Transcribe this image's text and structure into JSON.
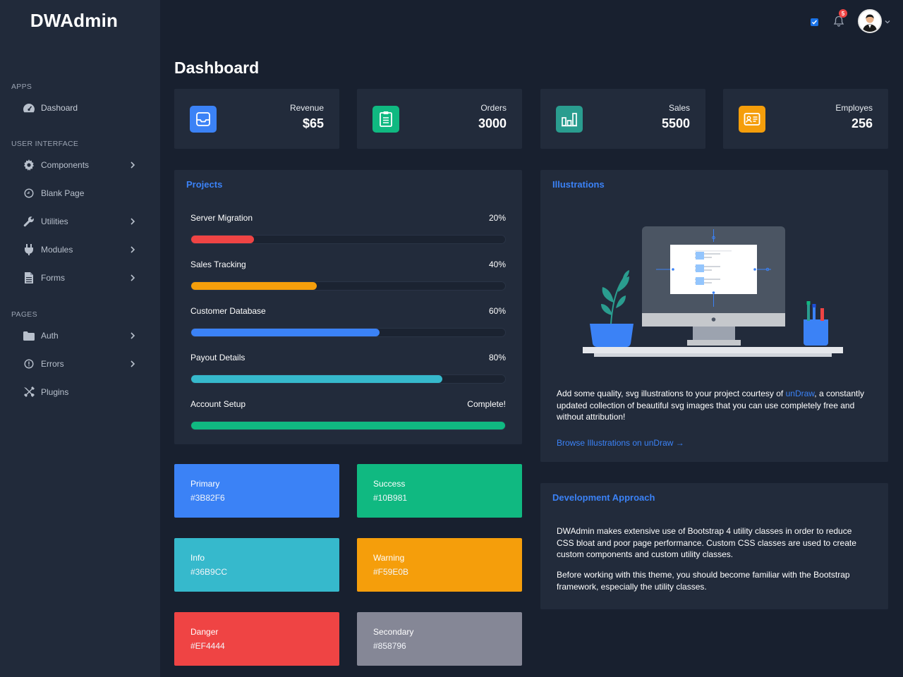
{
  "brand": "DWAdmin",
  "sidebar": {
    "sections": [
      {
        "title": "APPS"
      },
      {
        "title": "USER INTERFACE"
      },
      {
        "title": "PAGES"
      }
    ],
    "items": [
      {
        "label": "Dashoard",
        "icon": "tachometer-icon"
      },
      {
        "label": "Components",
        "icon": "gear-icon"
      },
      {
        "label": "Blank Page",
        "icon": "clock-icon"
      },
      {
        "label": "Utilities",
        "icon": "wrench-icon"
      },
      {
        "label": "Modules",
        "icon": "plug-icon"
      },
      {
        "label": "Forms",
        "icon": "file-icon"
      },
      {
        "label": "Auth",
        "icon": "folder-icon"
      },
      {
        "label": "Errors",
        "icon": "info-circle-icon"
      },
      {
        "label": "Plugins",
        "icon": "tools-icon"
      }
    ]
  },
  "topbar": {
    "notification_count": "5"
  },
  "page": {
    "title": "Dashboard"
  },
  "stats": [
    {
      "label": "Revenue",
      "value": "$65",
      "color": "#3B82F6",
      "icon": "inbox-icon"
    },
    {
      "label": "Orders",
      "value": "3000",
      "color": "#10B981",
      "icon": "clipboard-list-icon"
    },
    {
      "label": "Sales",
      "value": "5500",
      "color": "#36B9CC",
      "icon": "bar-chart-icon"
    },
    {
      "label": "Employes",
      "value": "256",
      "color": "#F59E0B",
      "icon": "id-card-icon"
    }
  ],
  "projects": {
    "title": "Projects",
    "items": [
      {
        "name": "Server Migration",
        "label": "20%",
        "progress": 0.2,
        "color": "#EF4444"
      },
      {
        "name": "Sales Tracking",
        "label": "40%",
        "progress": 0.4,
        "color": "#F59E0B"
      },
      {
        "name": "Customer Database",
        "label": "60%",
        "progress": 0.6,
        "color": "#3B82F6"
      },
      {
        "name": "Payout Details",
        "label": "80%",
        "progress": 0.8,
        "color": "#36B9CC"
      },
      {
        "name": "Account Setup",
        "label": "Complete!",
        "progress": 1.0,
        "color": "#10B981"
      }
    ]
  },
  "color_cards": [
    {
      "name": "Primary",
      "hex": "#3B82F6"
    },
    {
      "name": "Success",
      "hex": "#10B981"
    },
    {
      "name": "Info",
      "hex": "#36B9CC"
    },
    {
      "name": "Warning",
      "hex": "#F59E0B"
    },
    {
      "name": "Danger",
      "hex": "#EF4444"
    },
    {
      "name": "Secondary",
      "hex": "#858796"
    }
  ],
  "illustrations": {
    "title": "Illustrations",
    "text_before": "Add some quality, svg illustrations to your project courtesy of ",
    "link_undraw": "unDraw",
    "text_after": ", a constantly updated collection of beautiful svg images that you can use completely free and without attribution!",
    "browse_link": "Browse Illustrations on unDraw →"
  },
  "development": {
    "title": "Development Approach",
    "para1": "DWAdmin makes extensive use of Bootstrap 4 utility classes in order to reduce CSS bloat and poor page performance. Custom CSS classes are used to create custom components and custom utility classes.",
    "para2": "Before working with this theme, you should become familiar with the Bootstrap framework, especially the utility classes."
  }
}
